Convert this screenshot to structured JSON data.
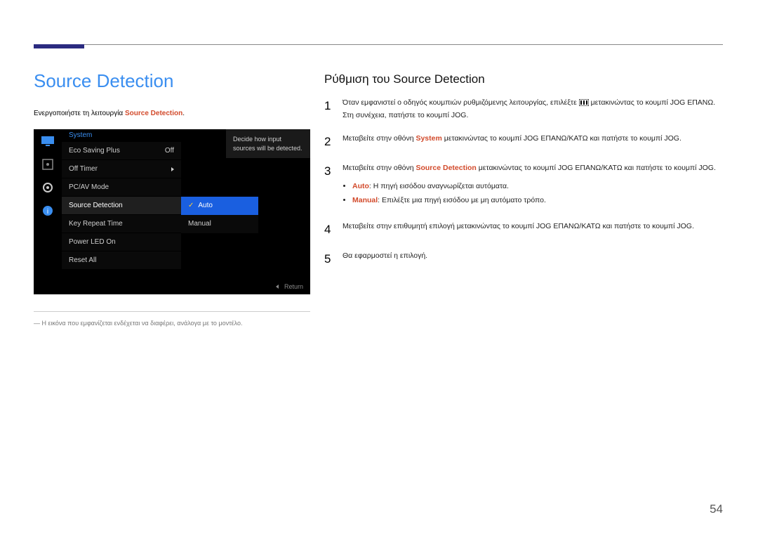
{
  "page_number": "54",
  "main_title": "Source Detection",
  "intro_prefix": "Ενεργοποιήστε τη λειτουργία ",
  "intro_strong": "Source Detection",
  "intro_suffix": ".",
  "caption": "Η εικόνα που εμφανίζεται ενδέχεται να διαφέρει, ανάλογα με το μοντέλο.",
  "right_title": "Ρύθμιση του Source Detection",
  "osd": {
    "header": "System",
    "desc": "Decide how input sources will be detected.",
    "footer_return": "Return",
    "items": [
      {
        "label": "Eco Saving Plus",
        "value": "Off"
      },
      {
        "label": "Off Timer",
        "value": "chevron"
      },
      {
        "label": "PC/AV Mode",
        "value": ""
      },
      {
        "label": "Source Detection",
        "value": "",
        "selected": true
      },
      {
        "label": "Key Repeat Time",
        "value": ""
      },
      {
        "label": "Power LED On",
        "value": ""
      },
      {
        "label": "Reset All",
        "value": ""
      }
    ],
    "sub": [
      {
        "label": "Auto",
        "selected": true
      },
      {
        "label": "Manual",
        "selected": false
      }
    ]
  },
  "steps": {
    "s1a": "Όταν εμφανιστεί ο οδηγός κουμπιών ρυθμιζόμενης λειτουργίας, επιλέξτε ",
    "s1b": " μετακινώντας το κουμπί JOG ΕΠΑΝΩ. Στη συνέχεια, πατήστε το κουμπί JOG.",
    "s2a": "Μεταβείτε στην οθόνη ",
    "s2_strong": "System",
    "s2b": " μετακινώντας το κουμπί JOG ΕΠΑΝΩ/ΚΑΤΩ και πατήστε το κουμπί JOG.",
    "s3a": "Μεταβείτε στην οθόνη ",
    "s3_strong": "Source Detection",
    "s3b": " μετακινώντας το κουμπί JOG ΕΠΑΝΩ/ΚΑΤΩ και πατήστε το κουμπί JOG.",
    "s3_b1_strong": "Auto",
    "s3_b1": ": Η πηγή εισόδου αναγνωρίζεται αυτόματα.",
    "s3_b2_strong": "Manual",
    "s3_b2": ": Επιλέξτε μια πηγή εισόδου με μη αυτόματο τρόπο.",
    "s4": "Μεταβείτε στην επιθυμητή επιλογή μετακινώντας το κουμπί JOG ΕΠΑΝΩ/ΚΑΤΩ και πατήστε το κουμπί JOG.",
    "s5": "Θα εφαρμοστεί η επιλογή."
  }
}
